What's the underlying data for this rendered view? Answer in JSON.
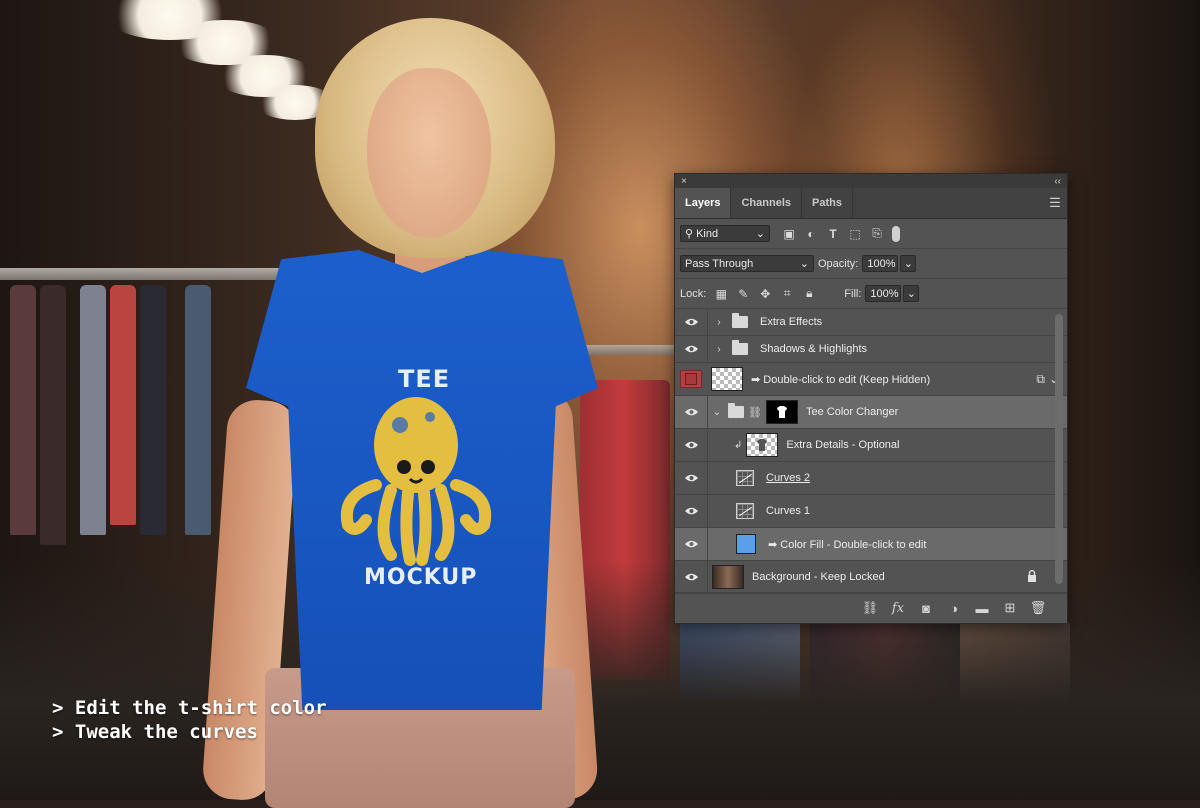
{
  "caption": {
    "line1": "> Edit the t-shirt color",
    "line2": "> Tweak the curves"
  },
  "shirt_print": {
    "top": "TEE",
    "bottom": "MOCKUP"
  },
  "panel": {
    "title_close": "×",
    "title_collapse": "‹‹",
    "tabs": [
      "Layers",
      "Channels",
      "Paths"
    ],
    "filter": {
      "kind": "Kind"
    },
    "blend_mode": "Pass Through",
    "opacity_label": "Opacity:",
    "opacity_value": "100%",
    "lock_label": "Lock:",
    "fill_label": "Fill:",
    "fill_value": "100%",
    "layers": [
      {
        "name": "Extra Effects",
        "type": "group",
        "visible": true
      },
      {
        "name": "Shadows & Highlights",
        "type": "group",
        "visible": true
      },
      {
        "name": "➡ Double-click to edit (Keep Hidden)",
        "type": "smart-object",
        "visible": false
      },
      {
        "name": "Tee Color Changer",
        "type": "group",
        "visible": true,
        "selected": true
      },
      {
        "name": "Extra Details - Optional",
        "type": "layer",
        "visible": true
      },
      {
        "name": "Curves 2",
        "type": "curves",
        "visible": true
      },
      {
        "name": "Curves 1",
        "type": "curves",
        "visible": true
      },
      {
        "name": "➡ Color Fill - Double-click to edit",
        "type": "fill",
        "visible": true,
        "selected": true,
        "swatch": "#5aa0e8"
      },
      {
        "name": "Background - Keep Locked",
        "type": "background",
        "visible": true,
        "locked": true
      }
    ]
  },
  "colors": {
    "shirt": "#1c5fcc",
    "panel_bg": "#535353",
    "hidden_layer_mark": "#b34141",
    "fill_swatch": "#5aa0e8"
  }
}
